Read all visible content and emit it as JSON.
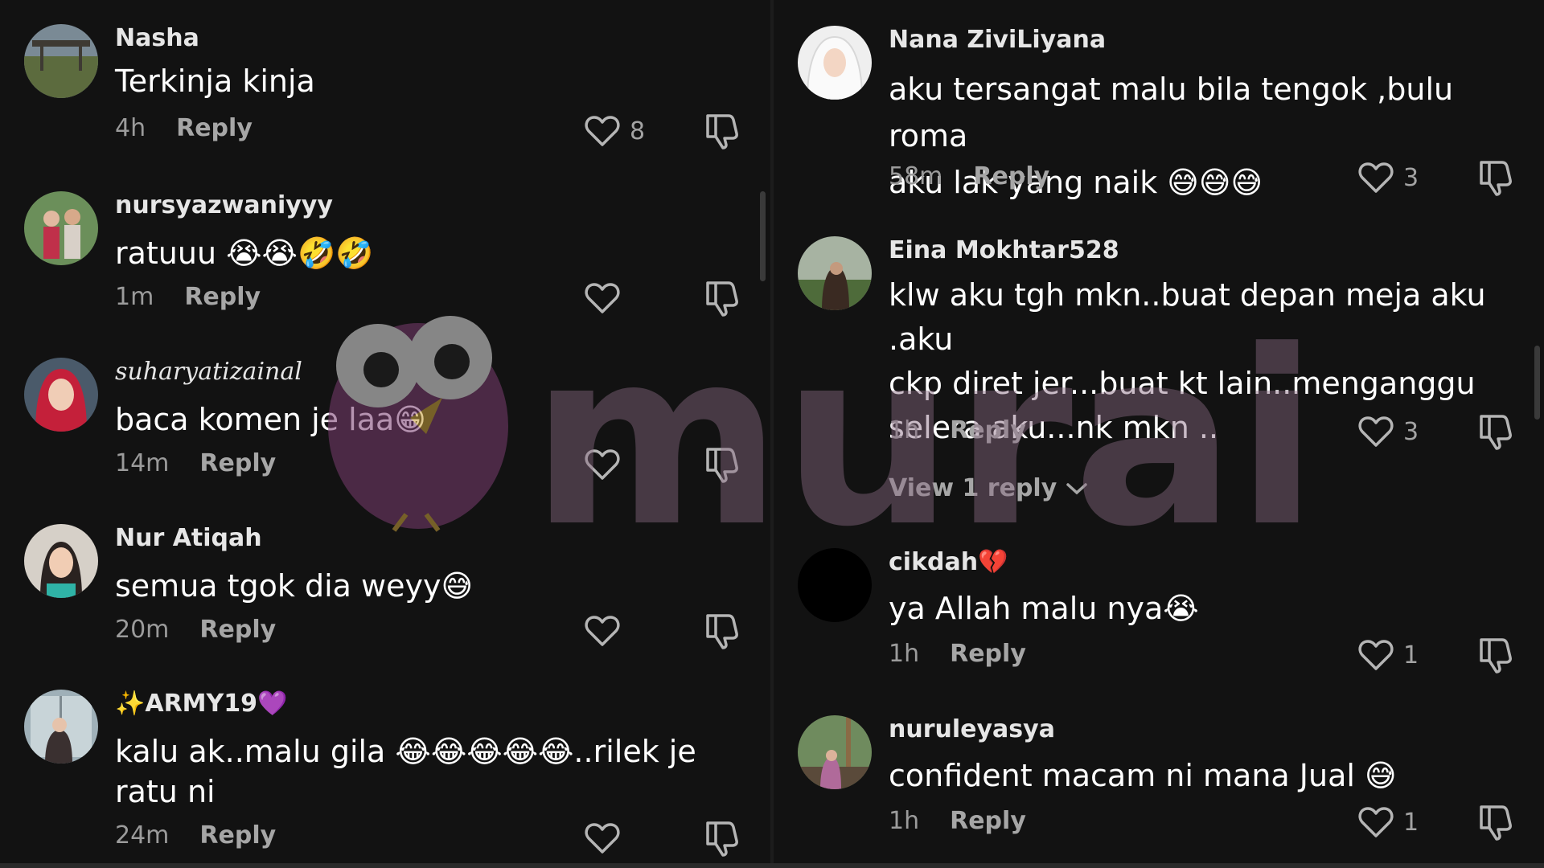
{
  "colors": {
    "background": "#121212",
    "watermark": "#8a6a82"
  },
  "watermark": {
    "text": "murai"
  },
  "left": {
    "comments": [
      {
        "username": "Nasha",
        "text": "Terkinja kinja",
        "time": "4h",
        "reply": "Reply",
        "likes": "8",
        "avatar": "avatar-park-photo"
      },
      {
        "username": "nursyazwaniyyy",
        "text": "ratuuu 😭😭🤣🤣",
        "time": "1m",
        "reply": "Reply",
        "likes": "",
        "avatar": "avatar-couple-photo"
      },
      {
        "username": "suharyatizainal",
        "text": "baca komen je laa😁",
        "time": "14m",
        "reply": "Reply",
        "likes": "",
        "avatar": "avatar-hijab-red"
      },
      {
        "username": "Nur Atiqah",
        "text": "semua tgok dia weyy😅",
        "time": "20m",
        "reply": "Reply",
        "likes": "",
        "avatar": "avatar-woman-portrait"
      },
      {
        "username": "✨ARMY19💜",
        "text": "kalu ak..malu gila 😂😂😂😂😂..rilek je\nratu ni",
        "time": "24m",
        "reply": "Reply",
        "likes": "",
        "avatar": "avatar-window-photo"
      }
    ]
  },
  "right": {
    "comments": [
      {
        "username": "Nana ZiviLiyana",
        "text": "aku tersangat malu bila tengok ,bulu roma\naku lak yang naik 😅😅😅",
        "time": "58m",
        "reply": "Reply",
        "likes": "3",
        "avatar": "avatar-white-hijab"
      },
      {
        "username": "Eina Mokhtar528",
        "text": "klw aku tgh mkn..buat depan meja aku .aku\nckp diret jer...buat kt lain..menganggu\nselera aku...nk mkn ..",
        "time": "1h",
        "reply": "Reply",
        "likes": "3",
        "avatar": "avatar-garden-photo",
        "view_replies": "View 1 reply"
      },
      {
        "username": "cikdah💔",
        "text": "ya Allah malu nya😭",
        "time": "1h",
        "reply": "Reply",
        "likes": "1",
        "avatar": "avatar-black"
      },
      {
        "username": "nuruleyasya",
        "text": "confident macam ni mana Jual 😅",
        "time": "1h",
        "reply": "Reply",
        "likes": "1",
        "avatar": "avatar-outdoor-photo"
      }
    ]
  }
}
